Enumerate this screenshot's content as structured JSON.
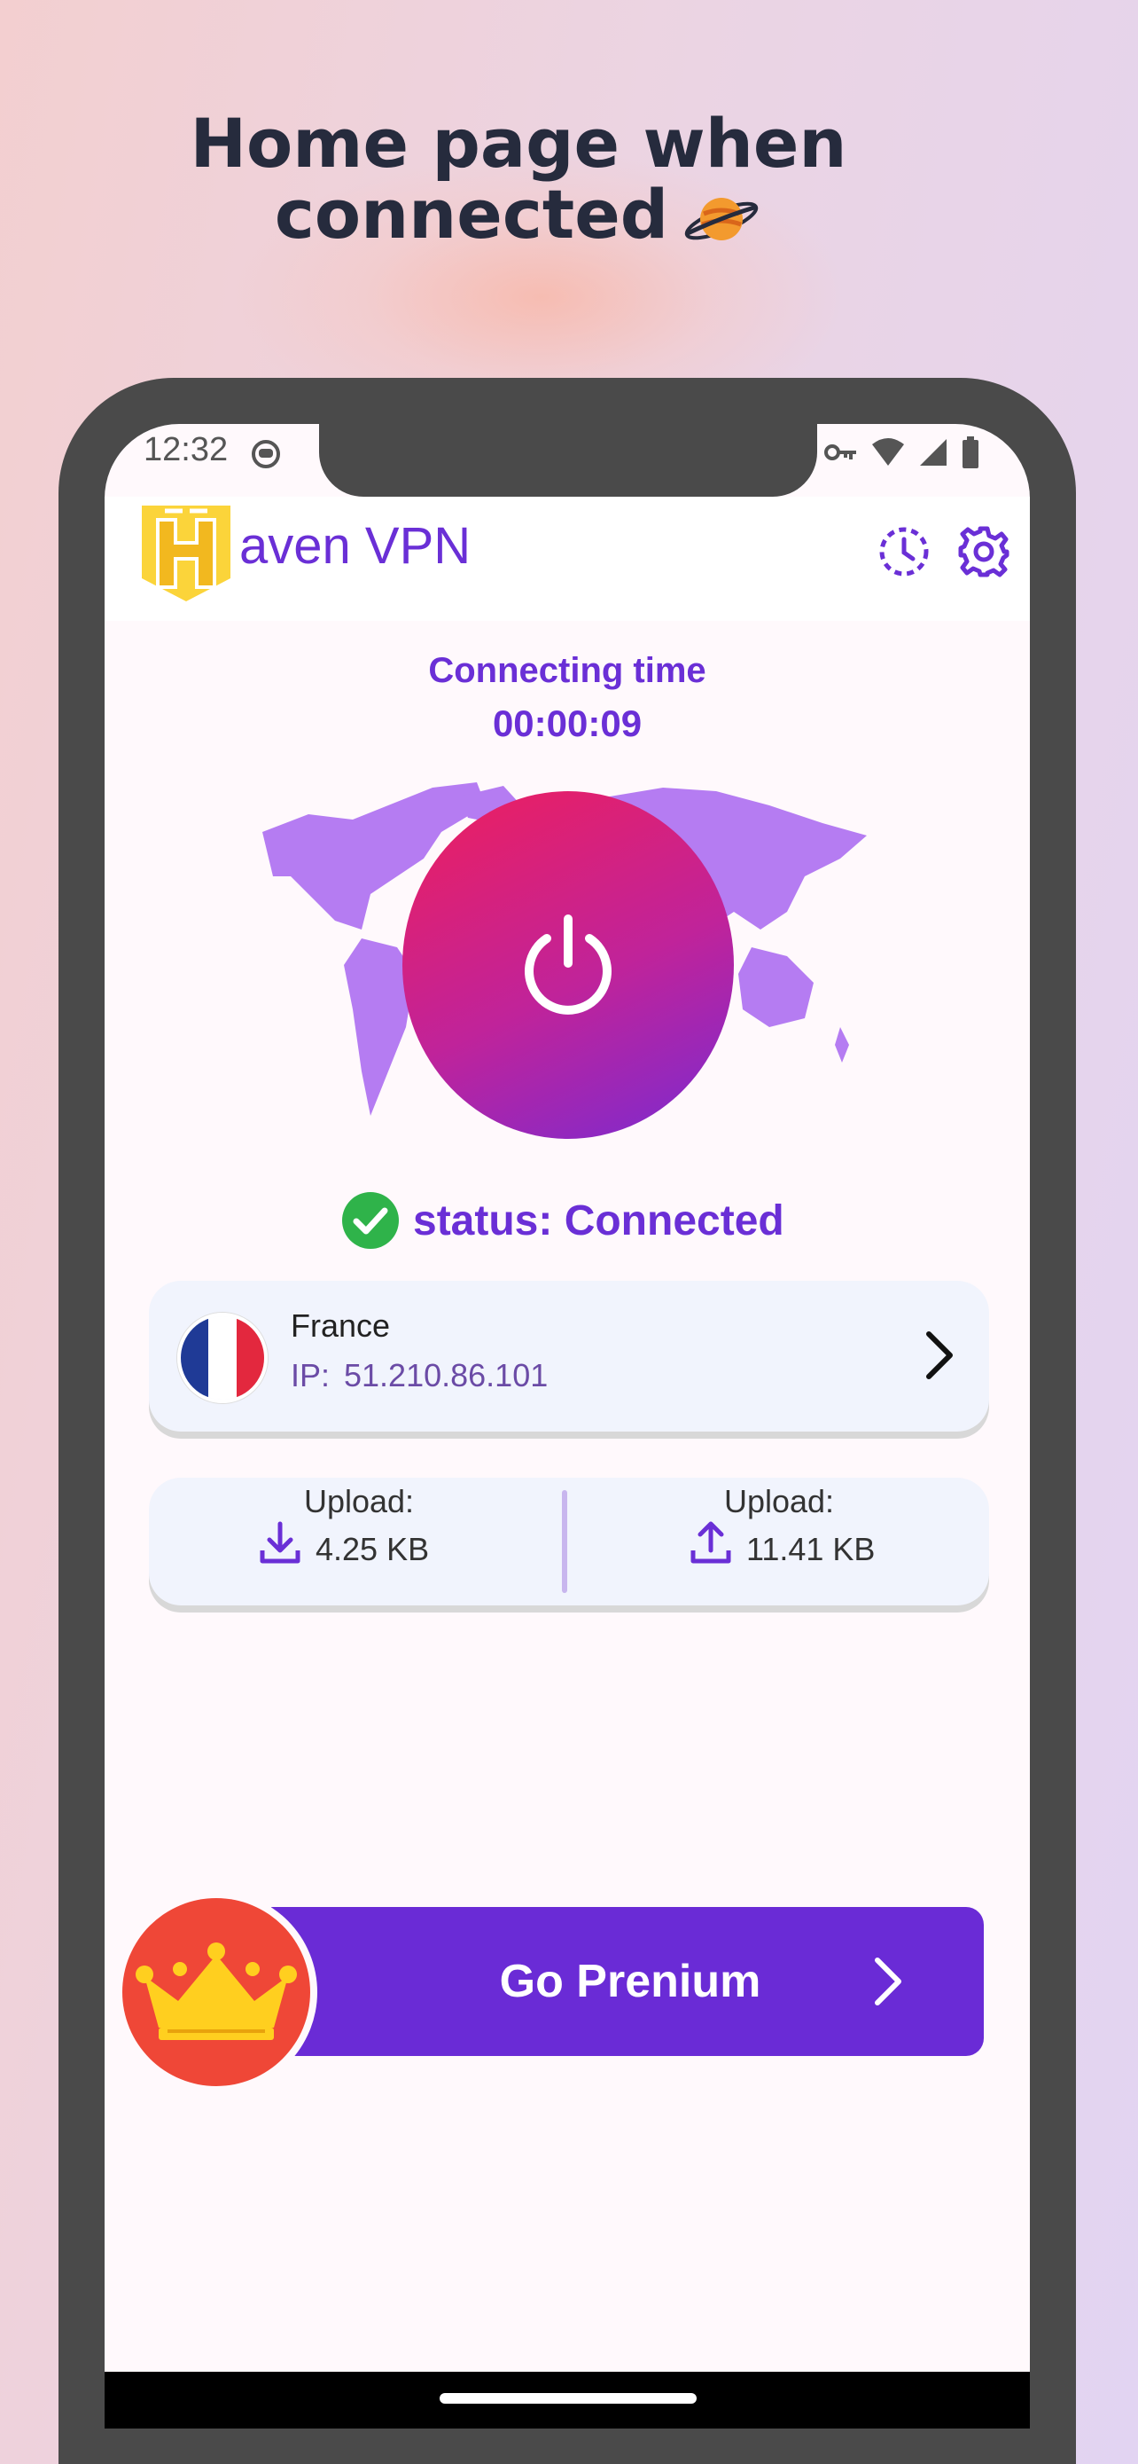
{
  "promo": {
    "headline_line1": "Home page when",
    "headline_line2": "connected",
    "headline_emoji": "planet-icon"
  },
  "status_bar": {
    "time": "12:32",
    "icons": [
      "android-icon",
      "key-icon",
      "wifi-icon",
      "signal-icon",
      "battery-icon"
    ]
  },
  "app_bar": {
    "brand_rest": "aven VPN",
    "logo_letter": "H",
    "history_icon": "history-icon",
    "settings_icon": "gear-icon"
  },
  "connection": {
    "time_label": "Connecting time",
    "time_value": "00:00:09",
    "status_text": "status: Connected"
  },
  "server": {
    "country": "France",
    "ip_prefix": "IP:",
    "ip_value": "51.210.86.101"
  },
  "traffic": {
    "download_label": "Upload:",
    "download_value": "4.25 KB",
    "upload_label": "Upload:",
    "upload_value": "11.41 KB"
  },
  "premium": {
    "label": "Go Prenium"
  },
  "colors": {
    "accent": "#6a2bd6",
    "power_start": "#ee1f5d",
    "power_end": "#7a2bd1",
    "map": "#b57cf2",
    "connected_green": "#2fb34a",
    "crown_bg": "#ef4737",
    "logo_yellow": "#fbd43a"
  }
}
